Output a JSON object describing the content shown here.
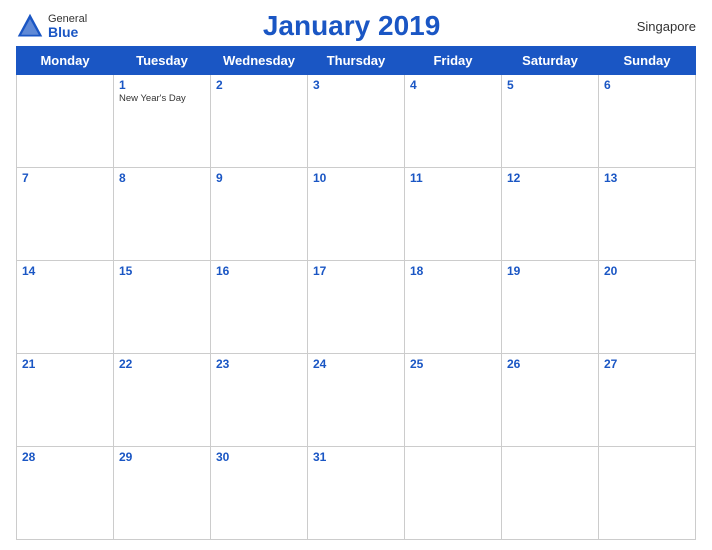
{
  "header": {
    "logo_general": "General",
    "logo_blue": "Blue",
    "title": "January 2019",
    "country": "Singapore"
  },
  "days_of_week": [
    "Monday",
    "Tuesday",
    "Wednesday",
    "Thursday",
    "Friday",
    "Saturday",
    "Sunday"
  ],
  "weeks": [
    [
      {
        "day": "",
        "empty": true
      },
      {
        "day": "1",
        "holiday": "New Year's Day"
      },
      {
        "day": "2"
      },
      {
        "day": "3"
      },
      {
        "day": "4"
      },
      {
        "day": "5"
      },
      {
        "day": "6"
      }
    ],
    [
      {
        "day": "7"
      },
      {
        "day": "8"
      },
      {
        "day": "9"
      },
      {
        "day": "10"
      },
      {
        "day": "11"
      },
      {
        "day": "12"
      },
      {
        "day": "13"
      }
    ],
    [
      {
        "day": "14"
      },
      {
        "day": "15"
      },
      {
        "day": "16"
      },
      {
        "day": "17"
      },
      {
        "day": "18"
      },
      {
        "day": "19"
      },
      {
        "day": "20"
      }
    ],
    [
      {
        "day": "21"
      },
      {
        "day": "22"
      },
      {
        "day": "23"
      },
      {
        "day": "24"
      },
      {
        "day": "25"
      },
      {
        "day": "26"
      },
      {
        "day": "27"
      }
    ],
    [
      {
        "day": "28"
      },
      {
        "day": "29"
      },
      {
        "day": "30"
      },
      {
        "day": "31"
      },
      {
        "day": "",
        "empty": true
      },
      {
        "day": "",
        "empty": true
      },
      {
        "day": "",
        "empty": true
      }
    ]
  ]
}
